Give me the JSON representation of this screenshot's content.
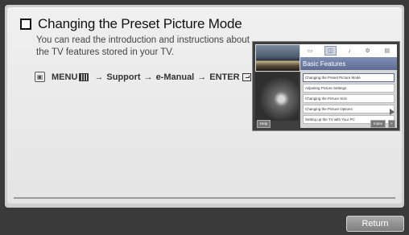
{
  "page": {
    "title": "Changing the Preset Picture Mode",
    "description": "You can read the introduction and instructions about the TV features stored in your TV.",
    "path": {
      "menu": "MENU",
      "arrow": "→",
      "support": "Support",
      "emanual": "e-Manual",
      "enter": "ENTER"
    }
  },
  "preview": {
    "header": "Basic Features",
    "tab_icons": [
      "tv-icon",
      "picture-icon",
      "sound-icon",
      "settings-icon",
      "more-icon"
    ],
    "items": [
      "Changing the Preset Picture Mode",
      "Adjusting Picture Settings",
      "Changing the Picture Size",
      "Changing the Picture Options",
      "Setting up the TV with Your PC"
    ],
    "help_label": "Help",
    "index_label": "Index",
    "close_label": "×"
  },
  "footer": {
    "return_label": "Return"
  },
  "colors": {
    "panel": "#ececec",
    "footer": "#3a3a3a",
    "accent": "#5c6c94"
  }
}
